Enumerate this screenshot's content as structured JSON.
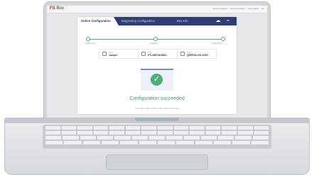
{
  "app": {
    "logo": "FS",
    "product": "Box"
  },
  "topnav": [
    "Documentation",
    "Documentation",
    "Need Help?",
    "En"
  ],
  "tabs": [
    {
      "label": "Online Configuration"
    },
    {
      "label": "Diagnosing Configuration"
    },
    {
      "label": "Box Info"
    }
  ],
  "steps": [
    "Choose Input",
    "Reading",
    "Configuration"
  ],
  "info": [
    {
      "label": "Switch",
      "value": "Juniper"
    },
    {
      "label": "Ports",
      "value": "FTLX8574D3BCL"
    },
    {
      "label": "Add",
      "value": "QSFP28-LR4-100G"
    }
  ],
  "status": {
    "message": "Configuration succeeded"
  },
  "footer": "Copyright © 2009-2019 FS.COM All Rights Reserved"
}
